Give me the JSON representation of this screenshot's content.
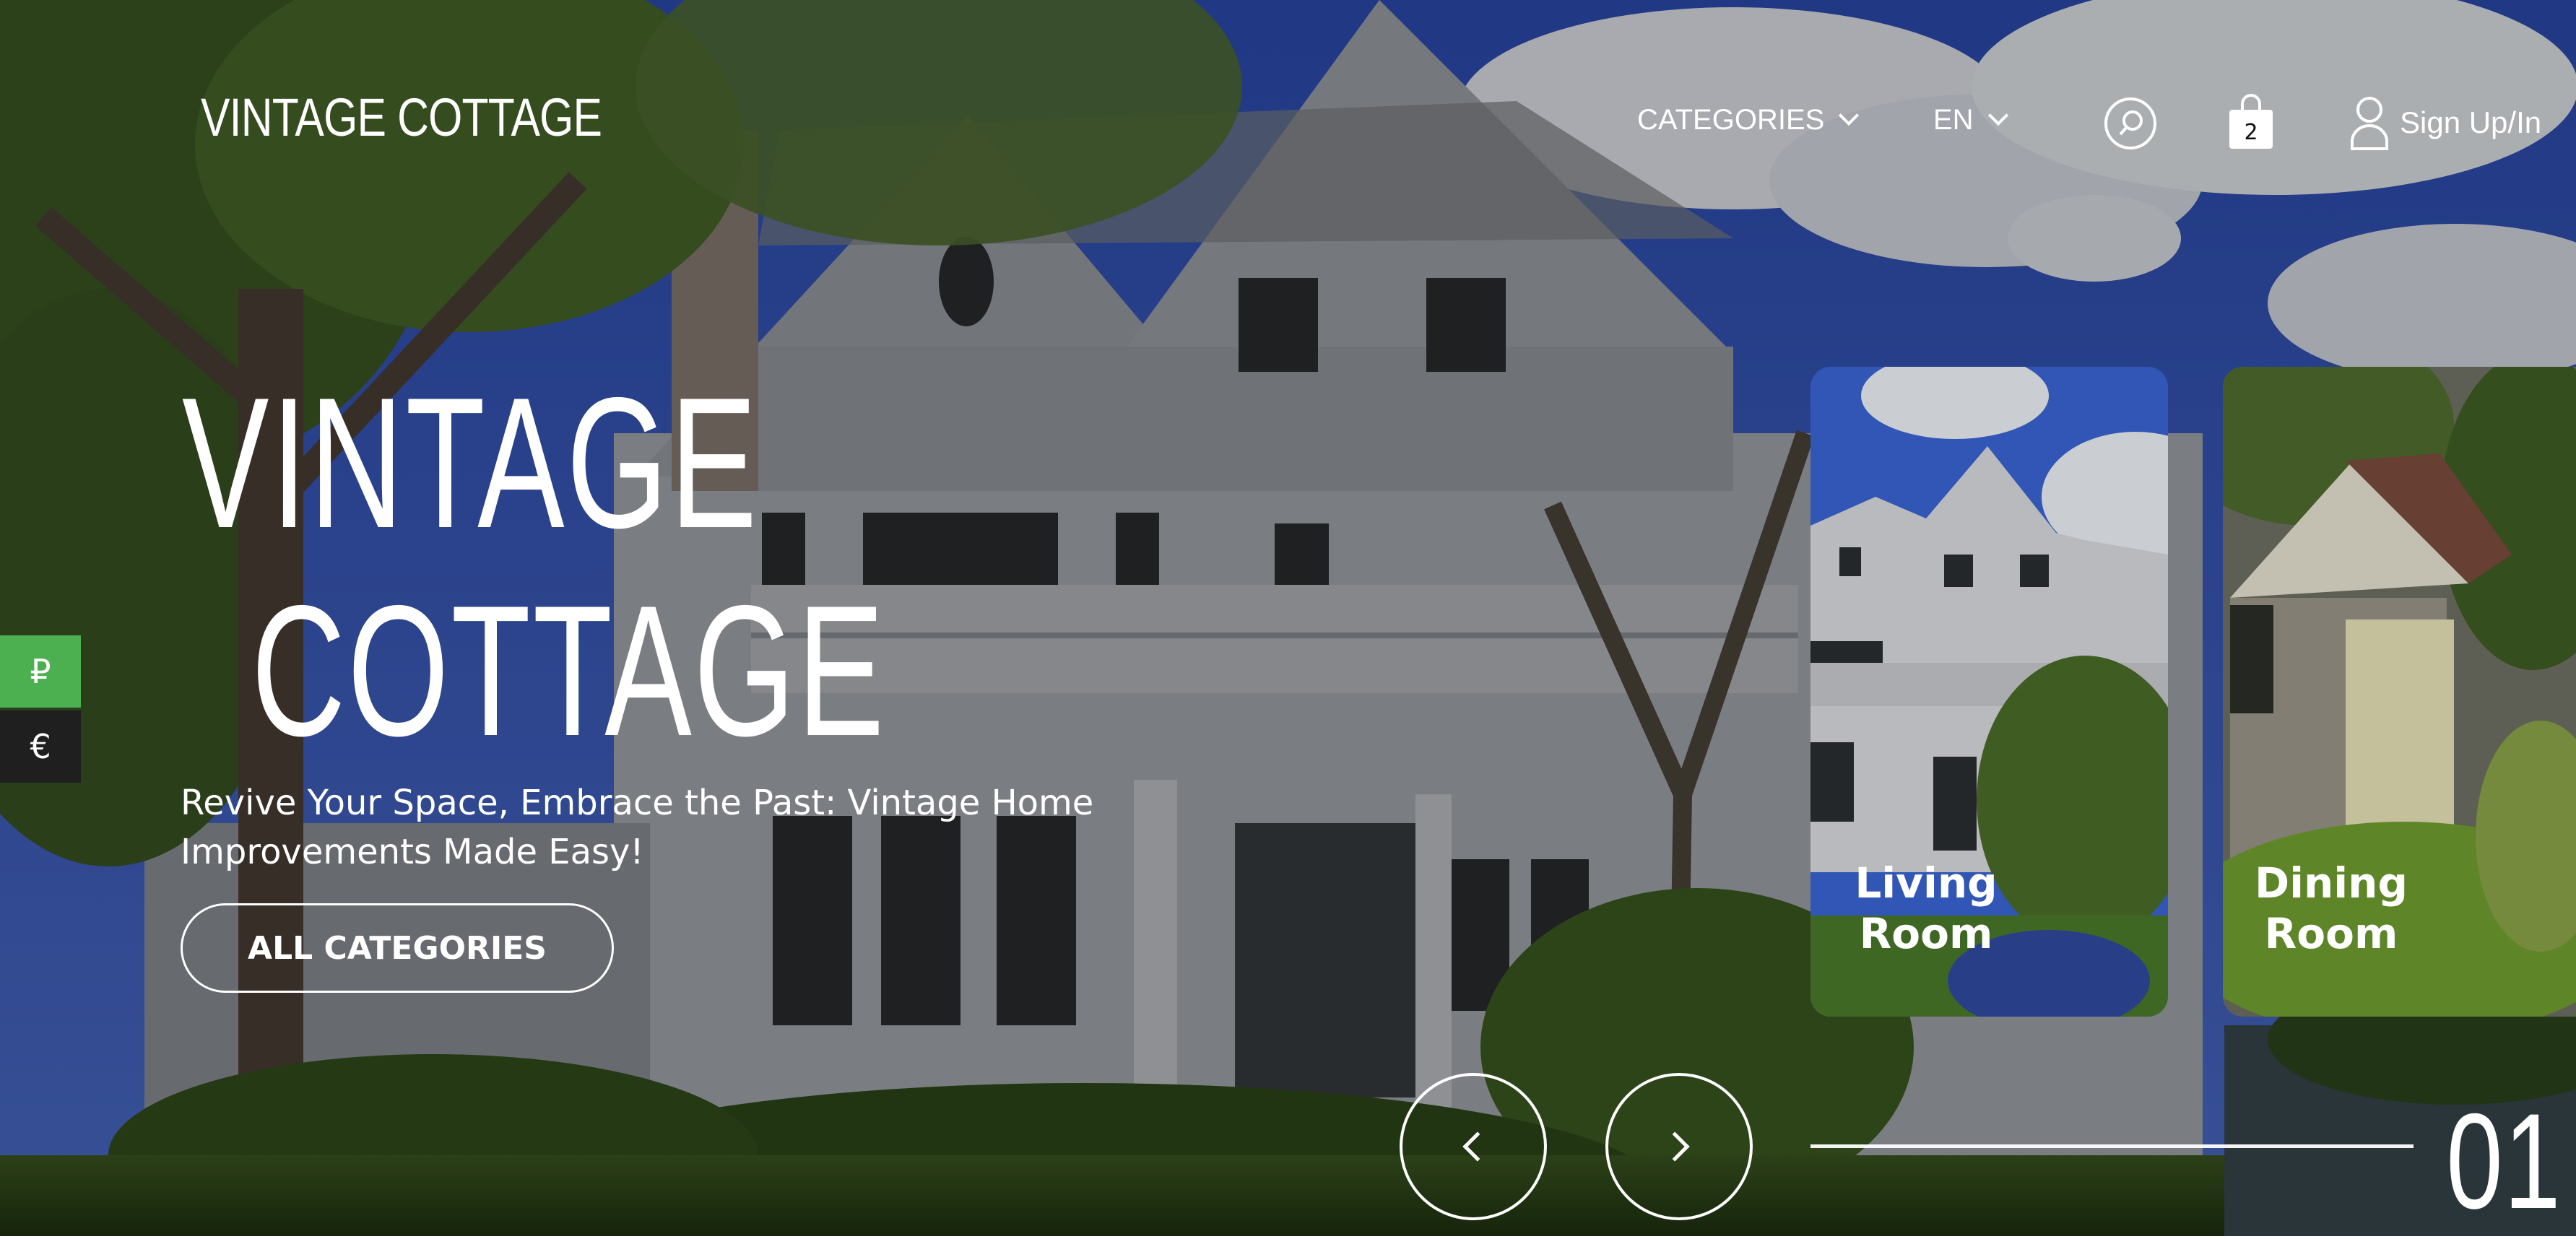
{
  "brand": {
    "logo": "VINTAGE COTTAGE"
  },
  "nav": {
    "categories_label": "CATEGORIES",
    "language_label": "EN",
    "cart_count": "2",
    "signin_label": "Sign Up/In"
  },
  "currency": {
    "ruble": "₽",
    "euro": "€",
    "active": "ruble"
  },
  "hero": {
    "title_line1": "VINTAGE",
    "title_line2": "COTTAGE",
    "subtitle": "Revive Your Space, Embrace the Past: Vintage Home Improvements Made Easy!",
    "cta_label": "ALL CATEGORIES"
  },
  "cards": [
    {
      "label_line1": "Living",
      "label_line2": "Room"
    },
    {
      "label_line1": "Dining",
      "label_line2": "Room"
    }
  ],
  "slider": {
    "counter": "01"
  },
  "colors": {
    "accent_green": "#4caf50",
    "dark_side": "#1f1f1f",
    "sky": "#3b5bbf"
  },
  "icons": [
    "search-icon",
    "shopping-bag-icon",
    "user-icon",
    "chevron-down-icon",
    "chevron-left-icon",
    "chevron-right-icon"
  ]
}
